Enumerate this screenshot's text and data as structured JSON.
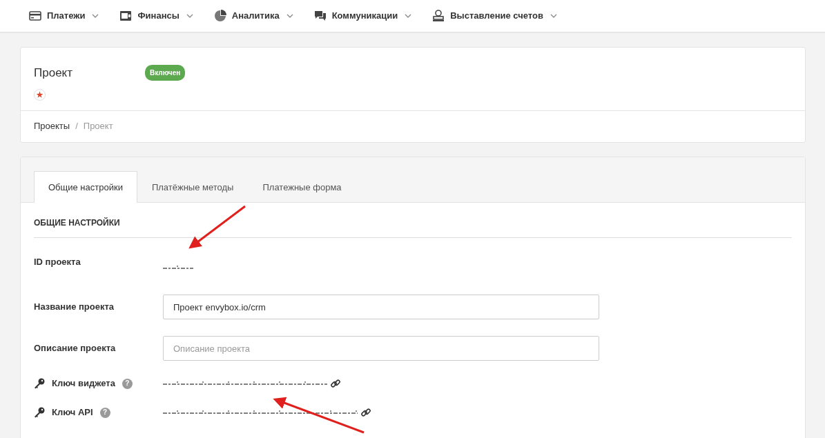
{
  "nav": [
    {
      "label": "Платежи"
    },
    {
      "label": "Финансы"
    },
    {
      "label": "Аналитика"
    },
    {
      "label": "Коммуникации"
    },
    {
      "label": "Выставление счетов"
    }
  ],
  "project": {
    "title": "Проект",
    "status": "Включен",
    "enabled": true,
    "favorite": true
  },
  "breadcrumb_separator": "/",
  "breadcrumb": [
    {
      "label": "Проекты",
      "current": false
    },
    {
      "label": "Проект",
      "current": true
    }
  ],
  "tabs": [
    {
      "label": "Общие настройки",
      "selected": true
    },
    {
      "label": "Платёжные методы",
      "selected": false
    },
    {
      "label": "Платежные форма",
      "selected": false
    }
  ],
  "section": {
    "title": "ОБЩИЕ НАСТРОЙКИ"
  },
  "fields": [
    {
      "kind": "redacted",
      "label": "ID проекта"
    },
    {
      "kind": "input",
      "label": "Название проекта",
      "value": "Проект envybox.io/crm"
    },
    {
      "kind": "input",
      "label": "Описание проекта",
      "placeholder": "Описание проекта"
    },
    {
      "kind": "secret",
      "label": "Ключ виджета",
      "help": "?"
    },
    {
      "kind": "secret",
      "label": "Ключ API",
      "help": "?"
    }
  ]
}
